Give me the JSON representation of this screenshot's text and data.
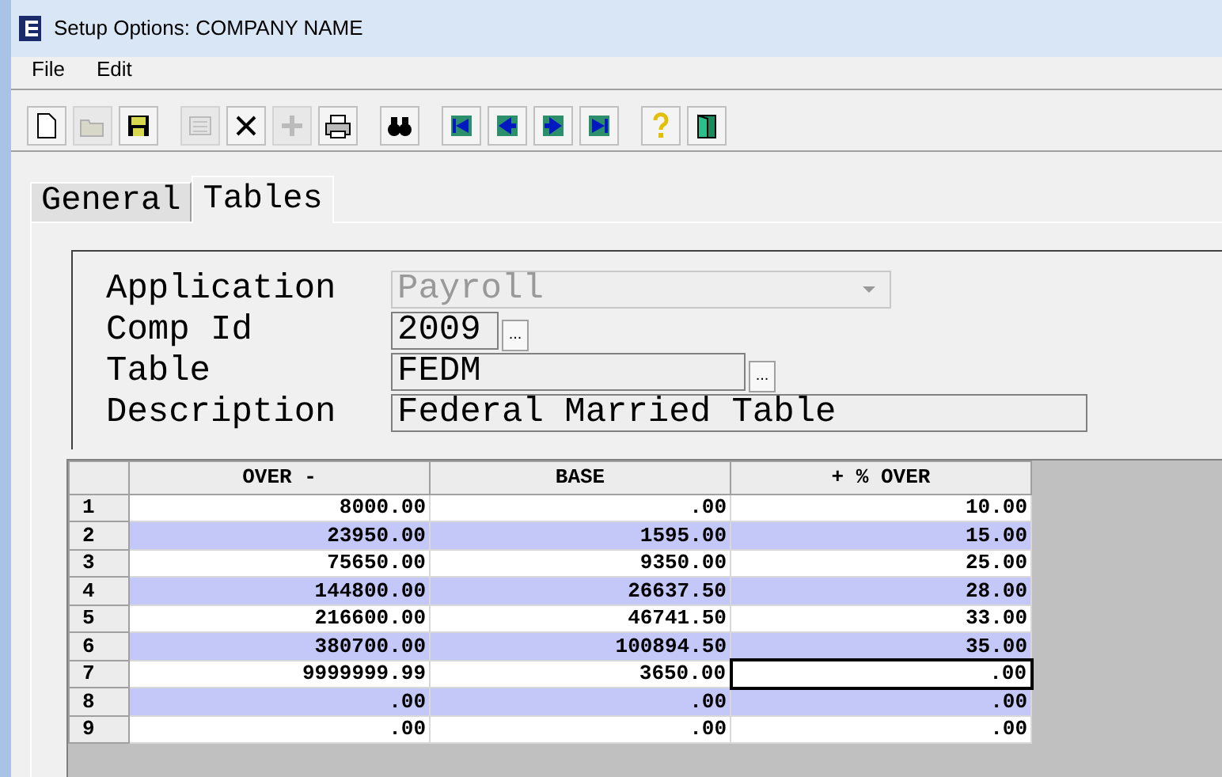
{
  "window": {
    "title": "Setup Options: COMPANY NAME"
  },
  "menu": [
    "File",
    "Edit"
  ],
  "toolbar": [
    {
      "kind": "new",
      "disabled": false
    },
    {
      "kind": "open",
      "disabled": true
    },
    {
      "kind": "save",
      "disabled": false
    },
    {
      "kind": "form",
      "disabled": true
    },
    {
      "kind": "delete",
      "disabled": false
    },
    {
      "kind": "add",
      "disabled": true
    },
    {
      "kind": "print",
      "disabled": false
    },
    {
      "kind": "find",
      "disabled": false
    },
    {
      "kind": "first",
      "disabled": false
    },
    {
      "kind": "prev",
      "disabled": false
    },
    {
      "kind": "next",
      "disabled": false
    },
    {
      "kind": "last",
      "disabled": false
    },
    {
      "kind": "help",
      "disabled": false
    },
    {
      "kind": "exit",
      "disabled": false
    }
  ],
  "tabs": [
    {
      "label": "General",
      "selected": false
    },
    {
      "label": "Tables",
      "selected": true
    }
  ],
  "form": [
    {
      "label": "Application",
      "kind": "dropdown",
      "value": "Payroll",
      "disabled": true
    },
    {
      "label": "Comp Id",
      "kind": "lookup",
      "value": "2009",
      "lookup": "..."
    },
    {
      "label": "Table",
      "kind": "lookup",
      "value": "FEDM",
      "lookup": "..."
    },
    {
      "label": "Description",
      "kind": "text",
      "value": "Federal Married Table"
    }
  ],
  "table": {
    "columns": [
      "OVER -",
      "BASE",
      "+ % OVER"
    ],
    "rows": [
      {
        "number": "1",
        "shaded": false,
        "cells": [
          {
            "text": "8000.00",
            "selected": false
          },
          {
            "text": ".00",
            "selected": false
          },
          {
            "text": "10.00",
            "selected": false
          }
        ]
      },
      {
        "number": "2",
        "shaded": true,
        "cells": [
          {
            "text": "23950.00",
            "selected": false
          },
          {
            "text": "1595.00",
            "selected": false
          },
          {
            "text": "15.00",
            "selected": false
          }
        ]
      },
      {
        "number": "3",
        "shaded": false,
        "cells": [
          {
            "text": "75650.00",
            "selected": false
          },
          {
            "text": "9350.00",
            "selected": false
          },
          {
            "text": "25.00",
            "selected": false
          }
        ]
      },
      {
        "number": "4",
        "shaded": true,
        "cells": [
          {
            "text": "144800.00",
            "selected": false
          },
          {
            "text": "26637.50",
            "selected": false
          },
          {
            "text": "28.00",
            "selected": false
          }
        ]
      },
      {
        "number": "5",
        "shaded": false,
        "cells": [
          {
            "text": "216600.00",
            "selected": false
          },
          {
            "text": "46741.50",
            "selected": false
          },
          {
            "text": "33.00",
            "selected": false
          }
        ]
      },
      {
        "number": "6",
        "shaded": true,
        "cells": [
          {
            "text": "380700.00",
            "selected": false
          },
          {
            "text": "100894.50",
            "selected": false
          },
          {
            "text": "35.00",
            "selected": false
          }
        ]
      },
      {
        "number": "7",
        "shaded": false,
        "cells": [
          {
            "text": "9999999.99",
            "selected": false
          },
          {
            "text": "3650.00",
            "selected": false
          },
          {
            "text": ".00",
            "selected": true
          }
        ]
      },
      {
        "number": "8",
        "shaded": true,
        "cells": [
          {
            "text": ".00",
            "selected": false
          },
          {
            "text": ".00",
            "selected": false
          },
          {
            "text": ".00",
            "selected": false
          }
        ]
      },
      {
        "number": "9",
        "shaded": false,
        "cells": [
          {
            "text": ".00",
            "selected": false
          },
          {
            "text": ".00",
            "selected": false
          },
          {
            "text": ".00",
            "selected": false
          }
        ]
      }
    ]
  }
}
